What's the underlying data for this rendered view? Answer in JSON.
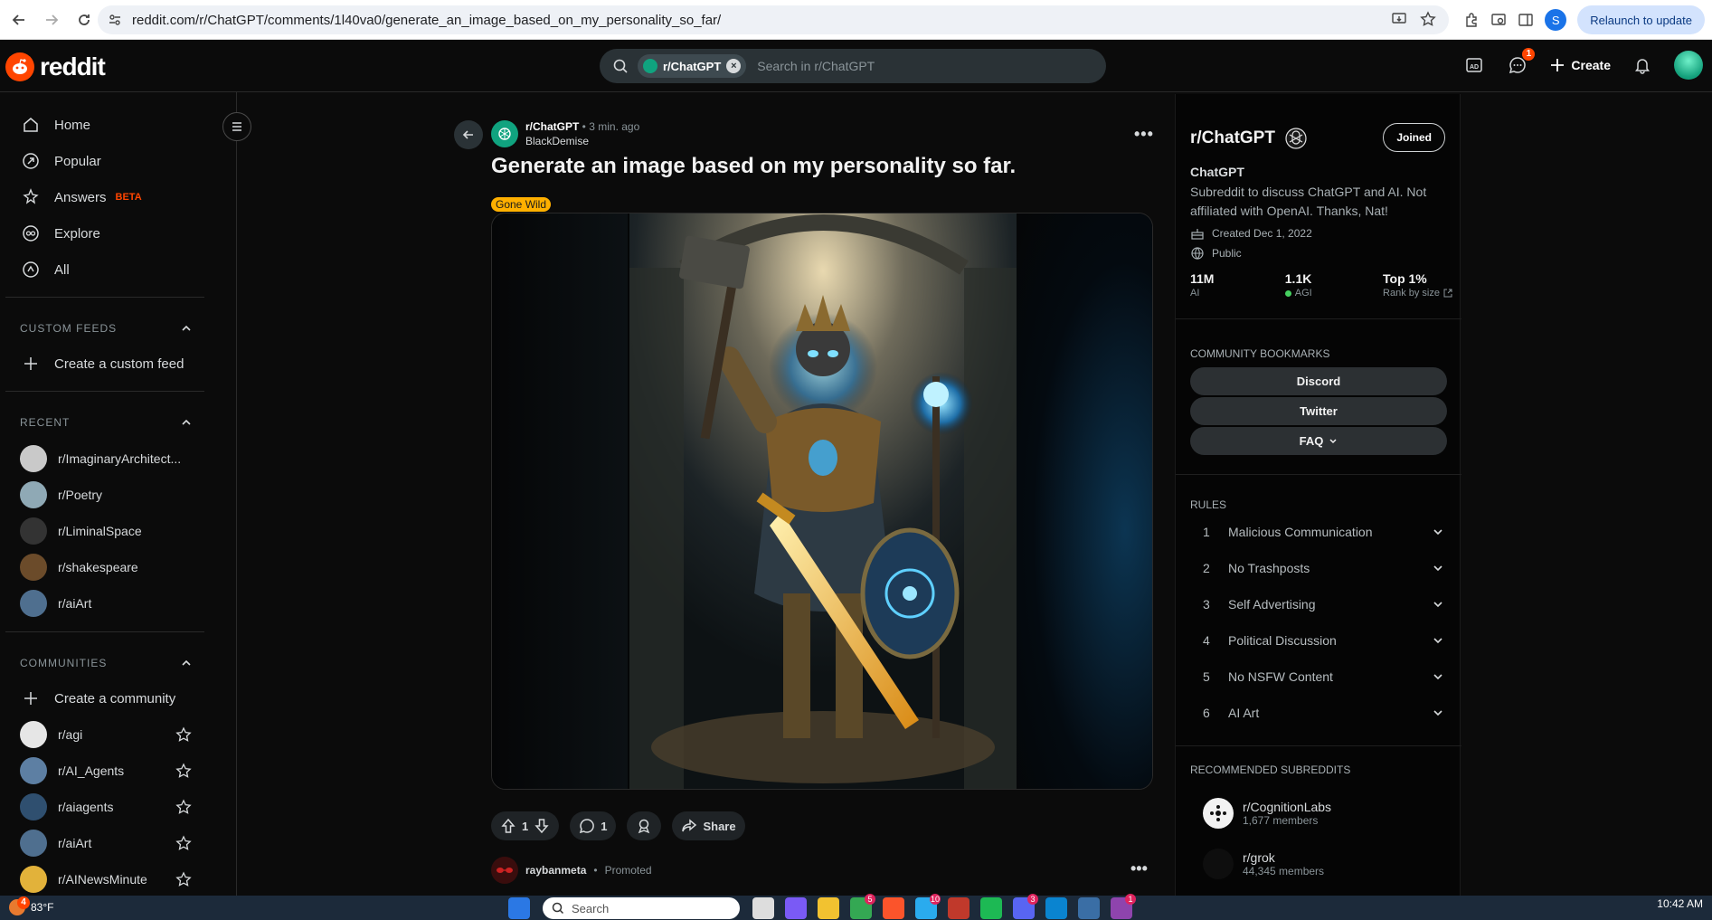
{
  "browser": {
    "url": "reddit.com/r/ChatGPT/comments/1l40va0/generate_an_image_based_on_my_personality_so_far/",
    "profile_initial": "S",
    "relaunch_label": "Relaunch to update"
  },
  "header": {
    "logo_text": "reddit",
    "search_chip": "r/ChatGPT",
    "search_placeholder": "Search in r/ChatGPT",
    "chat_badge": "1",
    "create_label": "Create"
  },
  "sidebar": {
    "nav": [
      {
        "label": "Home",
        "icon": "home-icon"
      },
      {
        "label": "Popular",
        "icon": "popular-icon"
      },
      {
        "label": "Answers",
        "icon": "answers-icon",
        "badge": "BETA"
      },
      {
        "label": "Explore",
        "icon": "explore-icon"
      },
      {
        "label": "All",
        "icon": "all-icon"
      }
    ],
    "custom_feeds": {
      "title": "CUSTOM FEEDS",
      "create": "Create a custom feed"
    },
    "recent": {
      "title": "RECENT",
      "items": [
        {
          "name": "r/ImaginaryArchitect...",
          "color": "#c9c9c9"
        },
        {
          "name": "r/Poetry",
          "color": "#8fa9b5"
        },
        {
          "name": "r/LiminalSpace",
          "color": "#333333"
        },
        {
          "name": "r/shakespeare",
          "color": "#6b4b2a"
        },
        {
          "name": "r/aiArt",
          "color": "#4f6f8f"
        }
      ]
    },
    "communities": {
      "title": "COMMUNITIES",
      "create": "Create a community",
      "items": [
        {
          "name": "r/agi",
          "color": "#e6e6e6"
        },
        {
          "name": "r/AI_Agents",
          "color": "#5d7fa3"
        },
        {
          "name": "r/aiagents",
          "color": "#2f4f6f"
        },
        {
          "name": "r/aiArt",
          "color": "#4f6f8f"
        },
        {
          "name": "r/AINewsMinute",
          "color": "#e2b23a"
        }
      ]
    }
  },
  "post": {
    "subreddit": "r/ChatGPT",
    "time": "3 min. ago",
    "author": "BlackDemise",
    "title": "Generate an image based on my personality so far.",
    "flair": "Gone Wild",
    "votes": "1",
    "comments": "1",
    "share_label": "Share",
    "promo_name": "raybanmeta",
    "promo_tag": "Promoted"
  },
  "community": {
    "title": "r/ChatGPT",
    "joined_label": "Joined",
    "name": "ChatGPT",
    "description": "Subreddit to discuss ChatGPT and AI. Not affiliated with OpenAI. Thanks, Nat!",
    "created": "Created Dec 1, 2022",
    "visibility": "Public",
    "stats": [
      {
        "value": "11M",
        "label": "AI"
      },
      {
        "value": "1.1K",
        "label": "AGI"
      },
      {
        "value": "Top 1%",
        "label": "Rank by size"
      }
    ],
    "bookmarks_title": "COMMUNITY BOOKMARKS",
    "bookmarks": [
      "Discord",
      "Twitter",
      "FAQ"
    ],
    "rules_title": "RULES",
    "rules": [
      {
        "num": "1",
        "text": "Malicious Communication"
      },
      {
        "num": "2",
        "text": "No Trashposts"
      },
      {
        "num": "3",
        "text": "Self Advertising"
      },
      {
        "num": "4",
        "text": "Political Discussion"
      },
      {
        "num": "5",
        "text": "No NSFW Content"
      },
      {
        "num": "6",
        "text": "AI Art"
      }
    ],
    "recommended_title": "RECOMMENDED SUBREDDITS",
    "recommended": [
      {
        "name": "r/CognitionLabs",
        "members": "1,677 members"
      },
      {
        "name": "r/grok",
        "members": "44,345 members"
      }
    ]
  },
  "taskbar": {
    "weather_badge": "4",
    "temperature": "83°F",
    "search_placeholder": "Search",
    "badges": [
      "5",
      "10",
      "3",
      "1"
    ],
    "time": "10:42 AM"
  },
  "colors": {
    "accent": "#ff4500",
    "chatgpt": "#10a37f",
    "flair": "#ffb000"
  }
}
